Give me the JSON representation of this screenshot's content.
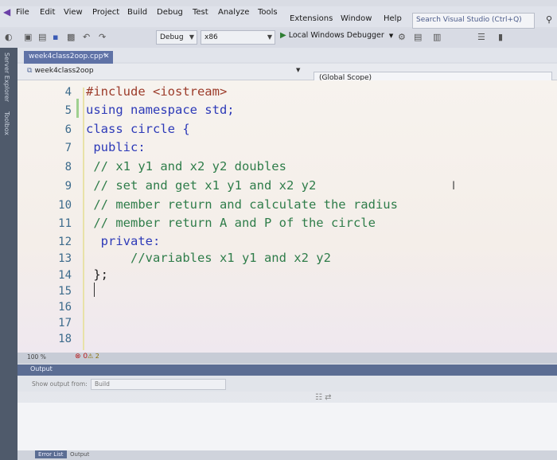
{
  "menu": {
    "items": [
      "File",
      "Edit",
      "View",
      "Project",
      "Build",
      "Debug",
      "Test",
      "Analyze",
      "Tools",
      "Extensions",
      "Window",
      "Help"
    ],
    "search_placeholder": "Search Visual Studio (Ctrl+Q)"
  },
  "toolbar": {
    "config": "Debug",
    "platform": "x86",
    "run_label": "Local Windows Debugger"
  },
  "side_tabs": [
    "Server Explorer",
    "Toolbox"
  ],
  "editor": {
    "tab_title": "week4class2oop.cpp*",
    "project": "week4class2oop",
    "scope": "(Global Scope)",
    "zoom": "100 %",
    "errors": "0",
    "warnings": "2",
    "lines": [
      {
        "n": "4",
        "text": "#include <iostream>"
      },
      {
        "n": "5",
        "text": "using namespace std;"
      },
      {
        "n": "6",
        "text": "class circle {"
      },
      {
        "n": "7",
        "text": " public:"
      },
      {
        "n": "8",
        "text": " // x1 y1 and x2 y2 doubles"
      },
      {
        "n": "9",
        "text": " // set and get x1 y1 and x2 y2"
      },
      {
        "n": "10",
        "text": " // member return and calculate the radius"
      },
      {
        "n": "11",
        "text": " // member return A and P of the circle"
      },
      {
        "n": "12",
        "text": "  private:"
      },
      {
        "n": "13",
        "text": "      //variables x1 y1 and x2 y2"
      },
      {
        "n": "14",
        "text": " };"
      },
      {
        "n": "15",
        "text": ""
      },
      {
        "n": "16",
        "text": ""
      },
      {
        "n": "17",
        "text": ""
      },
      {
        "n": "18",
        "text": ""
      }
    ]
  },
  "output": {
    "title": "Output",
    "show_from_label": "Show output from:",
    "source": "Build"
  },
  "bottom_tabs": [
    "Error List",
    "Output"
  ]
}
